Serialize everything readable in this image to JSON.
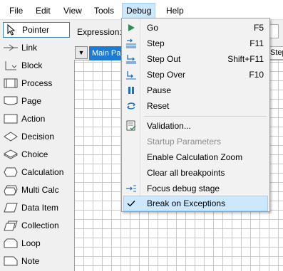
{
  "menubar": {
    "items": [
      {
        "label": "File"
      },
      {
        "label": "Edit"
      },
      {
        "label": "View"
      },
      {
        "label": "Tools"
      },
      {
        "label": "Debug",
        "active": true
      },
      {
        "label": "Help"
      }
    ]
  },
  "palette": {
    "items": [
      {
        "label": "Pointer",
        "icon": "pointer-icon",
        "selected": true
      },
      {
        "label": "Link",
        "icon": "link-icon"
      },
      {
        "label": "Block",
        "icon": "block-icon"
      },
      {
        "label": "Process",
        "icon": "process-icon"
      },
      {
        "label": "Page",
        "icon": "page-icon"
      },
      {
        "label": "Action",
        "icon": "action-icon"
      },
      {
        "label": "Decision",
        "icon": "decision-icon"
      },
      {
        "label": "Choice",
        "icon": "choice-icon"
      },
      {
        "label": "Calculation",
        "icon": "calculation-icon"
      },
      {
        "label": "Multi Calc",
        "icon": "multi-calc-icon"
      },
      {
        "label": "Data Item",
        "icon": "data-item-icon"
      },
      {
        "label": "Collection",
        "icon": "collection-icon"
      },
      {
        "label": "Loop",
        "icon": "loop-icon"
      },
      {
        "label": "Note",
        "icon": "note-icon"
      }
    ]
  },
  "expression": {
    "label": "Expression:",
    "value": ""
  },
  "tabs": {
    "main": "Main Pa",
    "right": "Step",
    "dropdown_glyph": "▼"
  },
  "debug_menu": {
    "items": [
      {
        "label": "Go",
        "shortcut": "F5",
        "icon": "go-icon"
      },
      {
        "label": "Step",
        "shortcut": "F11",
        "icon": "step-icon"
      },
      {
        "label": "Step Out",
        "shortcut": "Shift+F11",
        "icon": "step-out-icon"
      },
      {
        "label": "Step Over",
        "shortcut": "F10",
        "icon": "step-over-icon"
      },
      {
        "label": "Pause",
        "shortcut": "",
        "icon": "pause-icon"
      },
      {
        "label": "Reset",
        "shortcut": "",
        "icon": "reset-icon"
      },
      {
        "label": "Validation...",
        "shortcut": "",
        "icon": "validation-icon"
      },
      {
        "label": "Startup Parameters",
        "shortcut": "",
        "icon": "",
        "disabled": true
      },
      {
        "label": "Enable Calculation Zoom",
        "shortcut": "",
        "icon": ""
      },
      {
        "label": "Clear all breakpoints",
        "shortcut": "",
        "icon": ""
      },
      {
        "label": "Focus debug stage",
        "shortcut": "",
        "icon": "focus-debug-icon"
      },
      {
        "label": "Break on Exceptions",
        "shortcut": "",
        "icon": "checkmark-icon",
        "checked": true
      }
    ]
  },
  "colors": {
    "accent": "#1e7bd3",
    "highlight": "#cce8ff",
    "icon_blue": "#1e6fc4"
  }
}
